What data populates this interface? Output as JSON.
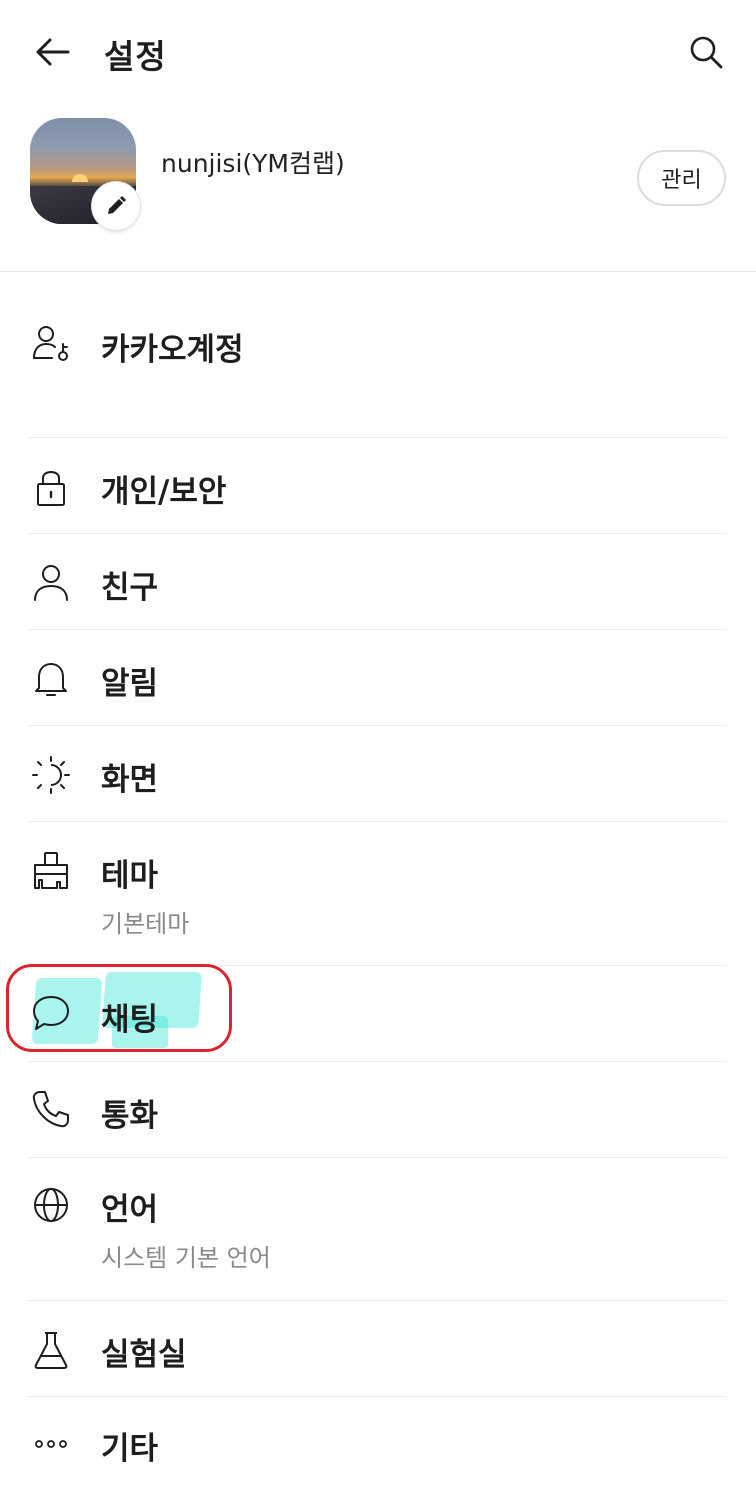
{
  "header": {
    "title": "설정",
    "back_icon": "arrow-left-icon",
    "search_icon": "search-icon"
  },
  "profile": {
    "name": "nunjisi(YM컴랩)",
    "manage_label": "관리",
    "edit_icon": "pencil-icon"
  },
  "menu": {
    "items": [
      {
        "label": "카카오계정",
        "sub": "",
        "icon": "account-key-icon"
      },
      {
        "label": "개인/보안",
        "sub": "",
        "icon": "lock-icon"
      },
      {
        "label": "친구",
        "sub": "",
        "icon": "person-icon"
      },
      {
        "label": "알림",
        "sub": "",
        "icon": "bell-icon"
      },
      {
        "label": "화면",
        "sub": "",
        "icon": "brightness-icon"
      },
      {
        "label": "테마",
        "sub": "기본테마",
        "icon": "paintbrush-icon"
      },
      {
        "label": "채팅",
        "sub": "",
        "icon": "chat-bubble-icon"
      },
      {
        "label": "통화",
        "sub": "",
        "icon": "phone-icon"
      },
      {
        "label": "언어",
        "sub": "시스템 기본 언어",
        "icon": "globe-icon"
      },
      {
        "label": "실험실",
        "sub": "",
        "icon": "flask-icon"
      },
      {
        "label": "기타",
        "sub": "",
        "icon": "more-dots-icon"
      }
    ]
  },
  "annotation": {
    "highlight_color": "#d9252e",
    "marker_color": "#40e6d6"
  }
}
